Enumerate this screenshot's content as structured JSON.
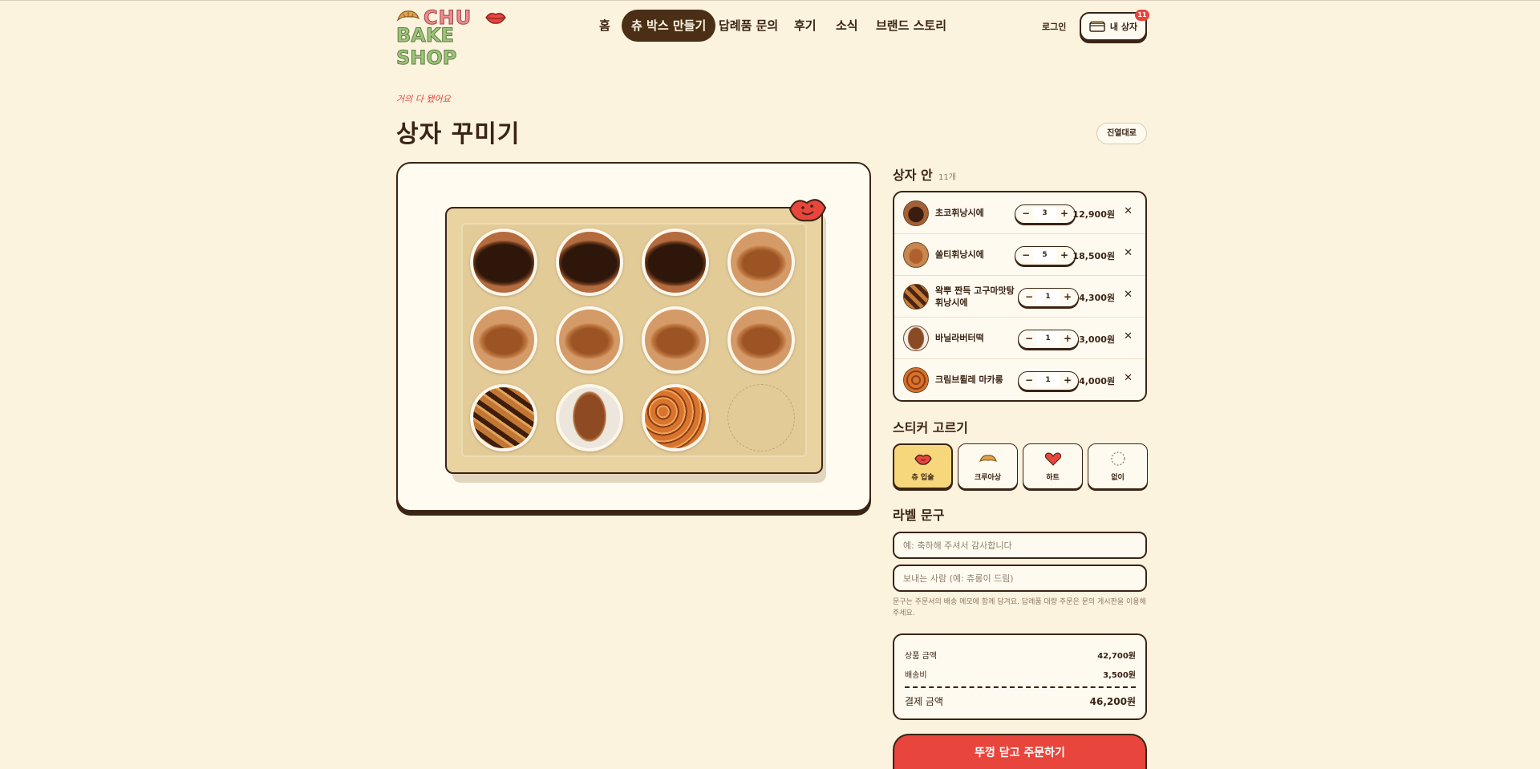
{
  "header": {
    "logo_line1": "CHU",
    "logo_line2": "BAKE SHOP",
    "nav": [
      {
        "label": "홈"
      },
      {
        "label": "츄 박스 만들기"
      },
      {
        "label": "답례품 문의"
      },
      {
        "label": "후기"
      },
      {
        "label": "소식"
      },
      {
        "label": "브랜드 스토리"
      }
    ],
    "login": "로그인",
    "mybox_label": "내 상자",
    "cart_count": "11"
  },
  "page": {
    "eyebrow": "거의 다 됐어요",
    "title": "상자 꾸미기",
    "shelf_button": "진열대로"
  },
  "box": {
    "slots": [
      "choco-financier",
      "choco-financier",
      "choco-financier",
      "salted-financier",
      "salted-financier",
      "salted-financier",
      "salted-financier",
      "salted-financier",
      "sweetpotato-financier",
      "vanilla-madeleine",
      "creme-brulee-macaron",
      "empty"
    ]
  },
  "cart": {
    "title": "상자 안",
    "count": "11개",
    "items": [
      {
        "name": "초코휘낭시에",
        "qty": "3",
        "price": "12,900원",
        "thumb": "choco"
      },
      {
        "name": "쏠티휘낭시에",
        "qty": "5",
        "price": "18,500원",
        "thumb": "salted"
      },
      {
        "name": "왁뿌 짠득 고구마맛탕 휘낭시에",
        "qty": "1",
        "price": "4,300원",
        "thumb": "sweetpotato"
      },
      {
        "name": "바닐라버터떡",
        "qty": "1",
        "price": "3,000원",
        "thumb": "vanilla"
      },
      {
        "name": "크림브륄레 마카롱",
        "qty": "1",
        "price": "4,000원",
        "thumb": "macaron"
      }
    ],
    "minus": "−",
    "plus": "+",
    "remove": "✕"
  },
  "stickers": {
    "title": "스티커 고르기",
    "options": [
      {
        "label": "츄 입술",
        "icon": "lips-icon",
        "selected": true
      },
      {
        "label": "크루아상",
        "icon": "croissant-icon",
        "selected": false
      },
      {
        "label": "하트",
        "icon": "heart-icon",
        "selected": false
      },
      {
        "label": "없이",
        "icon": "dashed-circle-icon",
        "selected": false
      }
    ]
  },
  "label": {
    "title": "라벨 문구",
    "message_placeholder": "예: 축하해 주셔서 감사합니다",
    "sender_placeholder": "보내는 사람 (예: 츄롱이 드림)",
    "hint": "문구는 주문서의 배송 메모에 함께 담겨요. 답례품 대량 주문은 문의 게시판을 이용해 주세요."
  },
  "summary": {
    "subtotal_label": "상품 금액",
    "subtotal": "42,700원",
    "shipping_label": "배송비",
    "shipping": "3,500원",
    "total_label": "결제 금액",
    "total": "46,200원"
  },
  "order_button": "뚜껑 닫고 주문하기",
  "colors": {
    "background": "#fcf3df",
    "ink": "#3a2414",
    "accent_red": "#e8453c",
    "sticker_selected": "#f6d77c",
    "tray": "#e8d3a1"
  }
}
